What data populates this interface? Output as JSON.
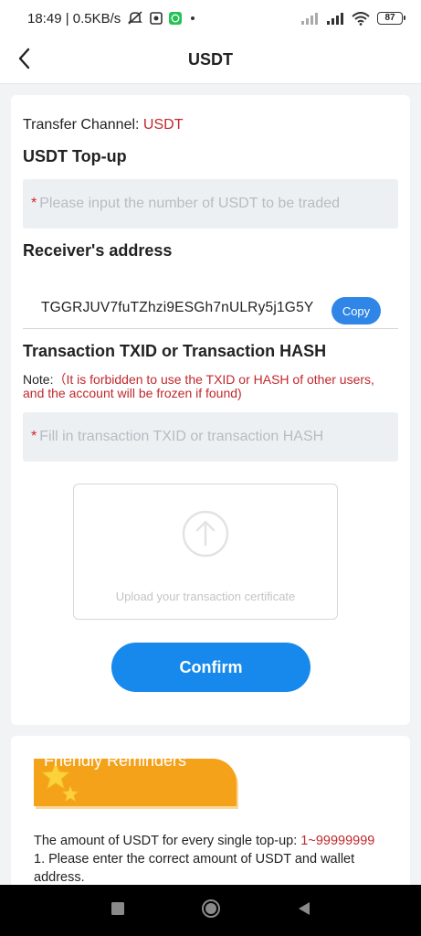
{
  "status_bar": {
    "time_speed": "18:49 | 0.5KB/s",
    "battery": "87",
    "icons": [
      "mute-icon",
      "app-icon",
      "whatsapp-icon",
      "dot-icon",
      "signal-icon",
      "signal-icon",
      "wifi-icon",
      "battery-icon"
    ]
  },
  "header": {
    "title": "USDT",
    "back_icon": "chevron-left-icon"
  },
  "transfer": {
    "channel_label": "Transfer Channel:",
    "channel_value": "USDT",
    "topup_title": "USDT Top-up",
    "amount_star": "*",
    "amount_placeholder": "Please input the number of USDT to be traded",
    "receiver_title": "Receiver's address",
    "address": "TGGRJUV7fuTZhzi9ESGh7nULRy5j1G5Y",
    "copy_label": "Copy",
    "txid_title": "Transaction TXID or Transaction HASH",
    "note_label": "Note:",
    "note_text": "（It is forbidden to use the TXID or HASH of other users, and the account will be frozen if found)",
    "txid_star": "*",
    "txid_placeholder": "Fill in transaction TXID or transaction HASH",
    "upload_label": "Upload your transaction certificate",
    "confirm_label": "Confirm"
  },
  "reminders": {
    "title": "Friendly Reminders",
    "line1_text": "The amount of USDT for every single top-up:",
    "line1_range": "1~99999999",
    "line2": "1. Please enter the correct amount of USDT and wallet address."
  },
  "colors": {
    "accent_blue": "#1789ec",
    "copy_blue": "#2f86e6",
    "red": "#c0282d",
    "ribbon_orange": "#f5a21b",
    "input_bg": "#edf0f3"
  }
}
